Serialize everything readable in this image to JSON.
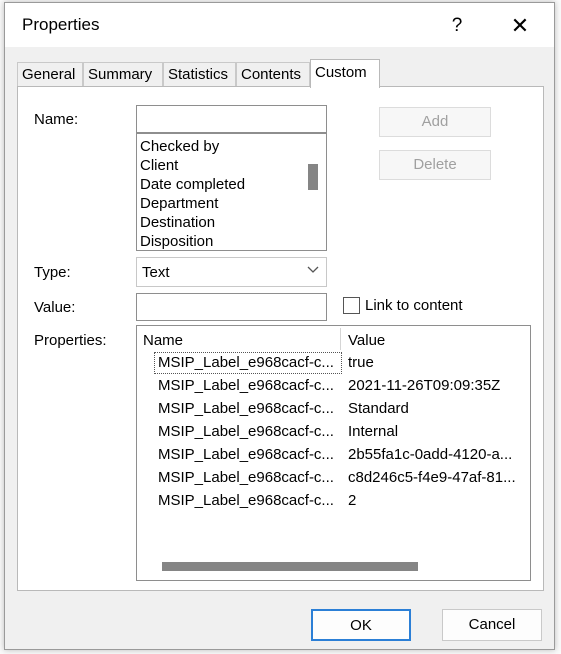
{
  "window": {
    "title": "Properties",
    "help_label": "?",
    "close_label": "✕"
  },
  "tabs": [
    "General",
    "Summary",
    "Statistics",
    "Contents",
    "Custom"
  ],
  "active_tab": "Custom",
  "form": {
    "name_label": "Name:",
    "name_value": "",
    "name_suggestions": [
      "Checked by",
      "Client",
      "Date completed",
      "Department",
      "Destination",
      "Disposition"
    ],
    "add_label": "Add",
    "delete_label": "Delete",
    "type_label": "Type:",
    "type_value": "Text",
    "value_label": "Value:",
    "value_value": "",
    "link_to_content_label": "Link to content",
    "link_to_content_checked": false,
    "properties_label": "Properties:"
  },
  "properties_table": {
    "columns": [
      "Name",
      "Value"
    ],
    "rows": [
      {
        "name": "MSIP_Label_e968cacf-c...",
        "value": "true"
      },
      {
        "name": "MSIP_Label_e968cacf-c...",
        "value": "2021-11-26T09:09:35Z"
      },
      {
        "name": "MSIP_Label_e968cacf-c...",
        "value": "Standard"
      },
      {
        "name": "MSIP_Label_e968cacf-c...",
        "value": "Internal"
      },
      {
        "name": "MSIP_Label_e968cacf-c...",
        "value": "2b55fa1c-0add-4120-a..."
      },
      {
        "name": "MSIP_Label_e968cacf-c...",
        "value": "c8d246c5-f4e9-47af-81..."
      },
      {
        "name": "MSIP_Label_e968cacf-c...",
        "value": "2"
      }
    ]
  },
  "buttons": {
    "ok_label": "OK",
    "cancel_label": "Cancel"
  },
  "icons": {
    "help": "question-mark-icon",
    "close": "close-icon",
    "dropdown": "chevron-down-icon"
  }
}
